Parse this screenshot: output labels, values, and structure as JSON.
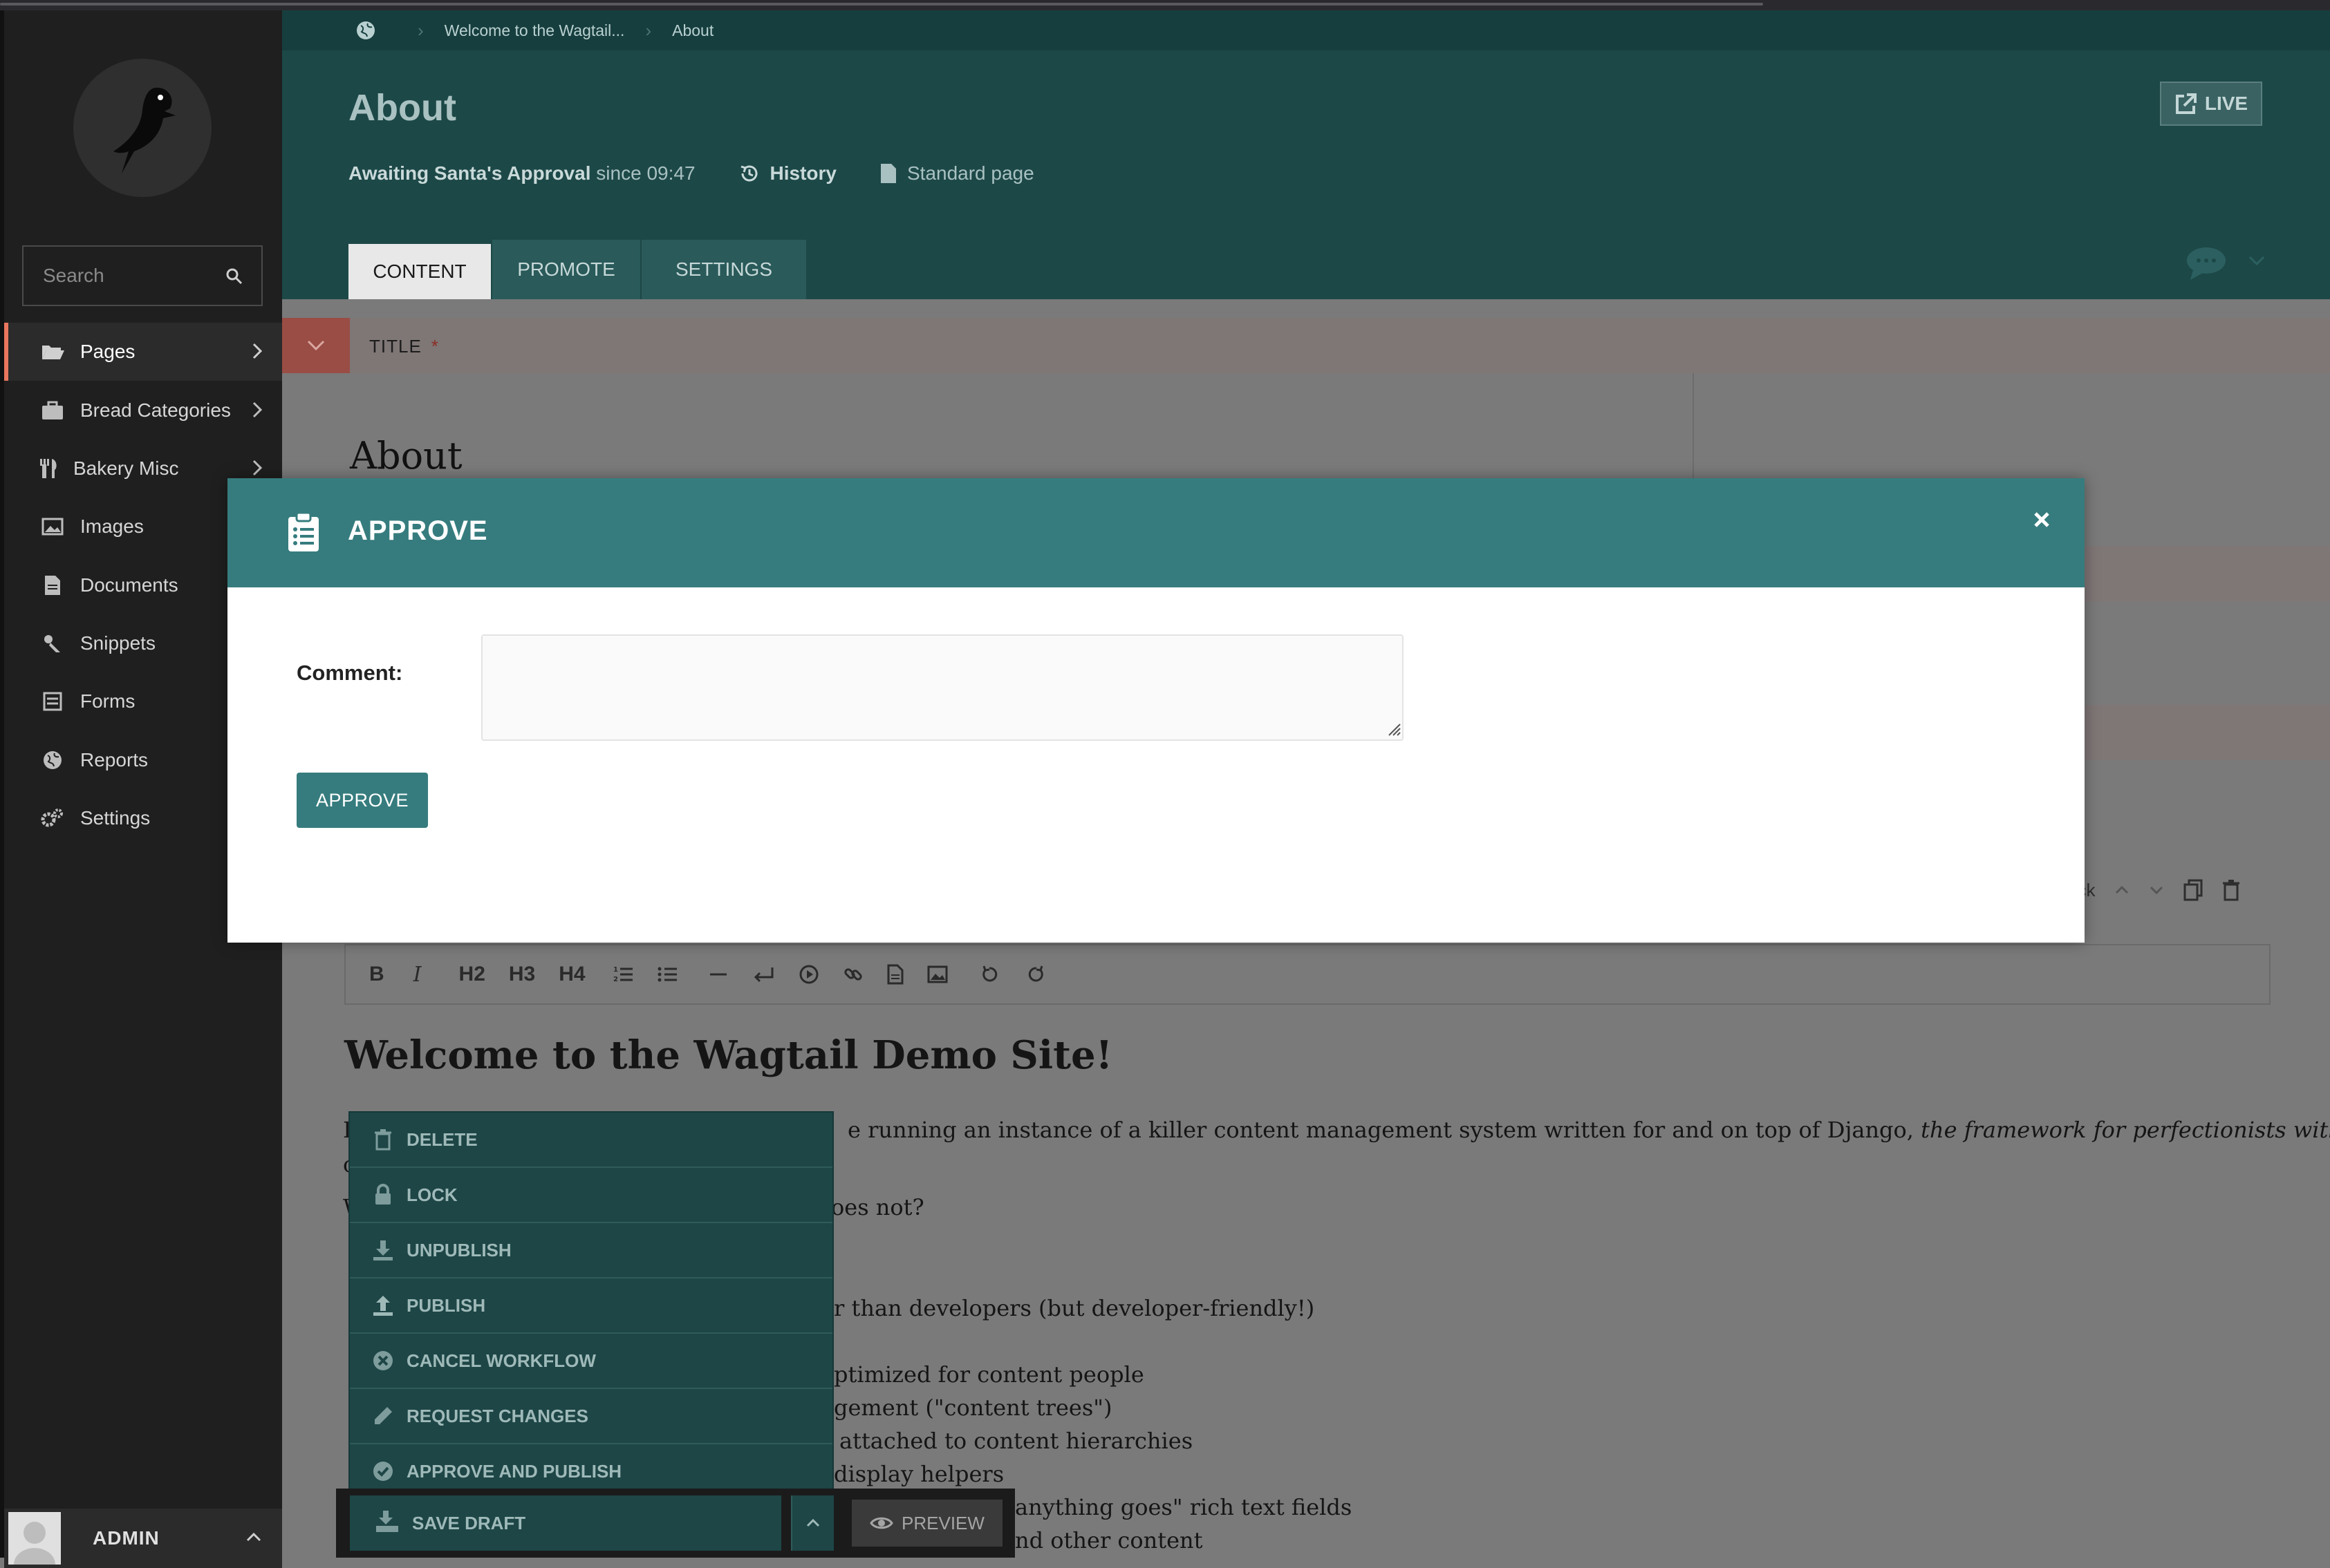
{
  "sidebar": {
    "search_placeholder": "Search",
    "items": [
      {
        "label": "Pages",
        "icon": "folder-open-icon",
        "has_submenu": true,
        "active": true
      },
      {
        "label": "Bread Categories",
        "icon": "suitcase-icon",
        "has_submenu": true
      },
      {
        "label": "Bakery Misc",
        "icon": "utensils-icon",
        "has_submenu": true
      },
      {
        "label": "Images",
        "icon": "image-icon"
      },
      {
        "label": "Documents",
        "icon": "doc-icon"
      },
      {
        "label": "Snippets",
        "icon": "snippet-icon"
      },
      {
        "label": "Forms",
        "icon": "form-icon"
      },
      {
        "label": "Reports",
        "icon": "globe-icon"
      },
      {
        "label": "Settings",
        "icon": "cogs-icon"
      }
    ],
    "user": {
      "name": "ADMIN"
    }
  },
  "header": {
    "breadcrumb": [
      "Welcome to the Wagtail...",
      "About"
    ],
    "title": "About",
    "status": "Awaiting Santa's Approval",
    "status_since": "since 09:47",
    "history_label": "History",
    "page_type": "Standard page",
    "live_label": "LIVE",
    "tabs": [
      "CONTENT",
      "PROMOTE",
      "SETTINGS"
    ]
  },
  "editor": {
    "title_label": "TITLE",
    "title_required": "*",
    "title_value": "About",
    "block_controls_label": "ock",
    "toolbar": [
      "B",
      "I",
      "H2",
      "H3",
      "H4"
    ],
    "heading": "Welcome to the Wagtail Demo Site!",
    "lines": [
      {
        "text": "I",
        "italic_tail": ""
      },
      {
        "text": "e running an instance of a killer content management system written for and on top of Django, ",
        "italic_tail": "the framework for perfectionists with"
      },
      {
        "text": "c",
        "italic_tail": ""
      },
      {
        "text": "W",
        "italic_tail": ""
      },
      {
        "text": "oes not?",
        "italic_tail": ""
      },
      {
        "text": "r than developers (but developer-friendly!)",
        "italic_tail": ""
      },
      {
        "text": "ptimized for content people",
        "italic_tail": ""
      },
      {
        "text": "gement (\"content trees\")",
        "italic_tail": ""
      },
      {
        "text": "attached to content hierarchies",
        "italic_tail": ""
      },
      {
        "text": "display helpers",
        "italic_tail": ""
      },
      {
        "text": "anything goes\" rich text fields",
        "italic_tail": ""
      },
      {
        "text": "nd other content",
        "italic_tail": ""
      }
    ]
  },
  "actions": {
    "items": [
      {
        "label": "DELETE",
        "icon": "trash-icon"
      },
      {
        "label": "LOCK",
        "icon": "lock-icon"
      },
      {
        "label": "UNPUBLISH",
        "icon": "download-icon"
      },
      {
        "label": "PUBLISH",
        "icon": "upload-icon"
      },
      {
        "label": "CANCEL WORKFLOW",
        "icon": "circle-x-icon"
      },
      {
        "label": "REQUEST CHANGES",
        "icon": "pencil-icon"
      },
      {
        "label": "APPROVE AND PUBLISH",
        "icon": "circle-check-icon"
      }
    ],
    "save_draft_label": "SAVE DRAFT",
    "preview_label": "PREVIEW"
  },
  "modal": {
    "title": "APPROVE",
    "comment_label": "Comment:",
    "comment_value": "",
    "submit_label": "APPROVE"
  },
  "colors": {
    "teal": "#367c7e",
    "header_teal": "#1d4848",
    "sidebar": "#1f1f1f",
    "active_accent": "#e9775e"
  }
}
